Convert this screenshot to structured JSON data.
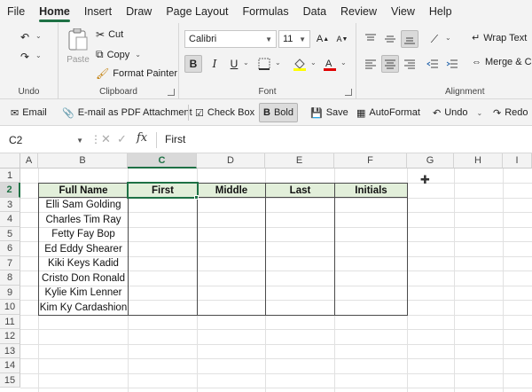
{
  "menu": [
    "File",
    "Home",
    "Insert",
    "Draw",
    "Page Layout",
    "Formulas",
    "Data",
    "Review",
    "View",
    "Help"
  ],
  "active_menu": "Home",
  "ribbon": {
    "undo_group": "Undo",
    "clipboard": {
      "label": "Clipboard",
      "paste": "Paste",
      "cut": "Cut",
      "copy": "Copy",
      "format_painter": "Format Painter"
    },
    "font": {
      "label": "Font",
      "name": "Calibri",
      "size": "11"
    },
    "alignment": {
      "label": "Alignment",
      "wrap_text": "Wrap Text",
      "merge": "Merge & C"
    }
  },
  "quickbar": {
    "email": "Email",
    "pdf": "E-mail as PDF Attachment",
    "checkbox": "Check Box",
    "bold": "Bold",
    "save": "Save",
    "autoformat": "AutoFormat",
    "undo": "Undo",
    "redo": "Redo"
  },
  "formula_bar": {
    "cell_ref": "C2",
    "value": "First"
  },
  "columns": [
    "A",
    "B",
    "C",
    "D",
    "E",
    "F",
    "G",
    "H",
    "I"
  ],
  "selected_column": "C",
  "rows": [
    "1",
    "2",
    "3",
    "4",
    "5",
    "6",
    "7",
    "8",
    "9",
    "10",
    "11",
    "12",
    "13",
    "14",
    "15"
  ],
  "selected_row": "2",
  "table": {
    "headers": [
      "Full Name",
      "First",
      "Middle",
      "Last",
      "Initials"
    ],
    "names": [
      "Elli Sam Golding",
      "Charles Tim Ray",
      "Fetty Fay Bop",
      "Ed Eddy Shearer",
      "Kiki Keys Kadid",
      "Cristo Don Ronald",
      "Kylie Kim Lenner",
      "Kim Ky Cardashion"
    ]
  },
  "colors": {
    "accent": "#1e7145",
    "header_fill": "#e2efda"
  }
}
